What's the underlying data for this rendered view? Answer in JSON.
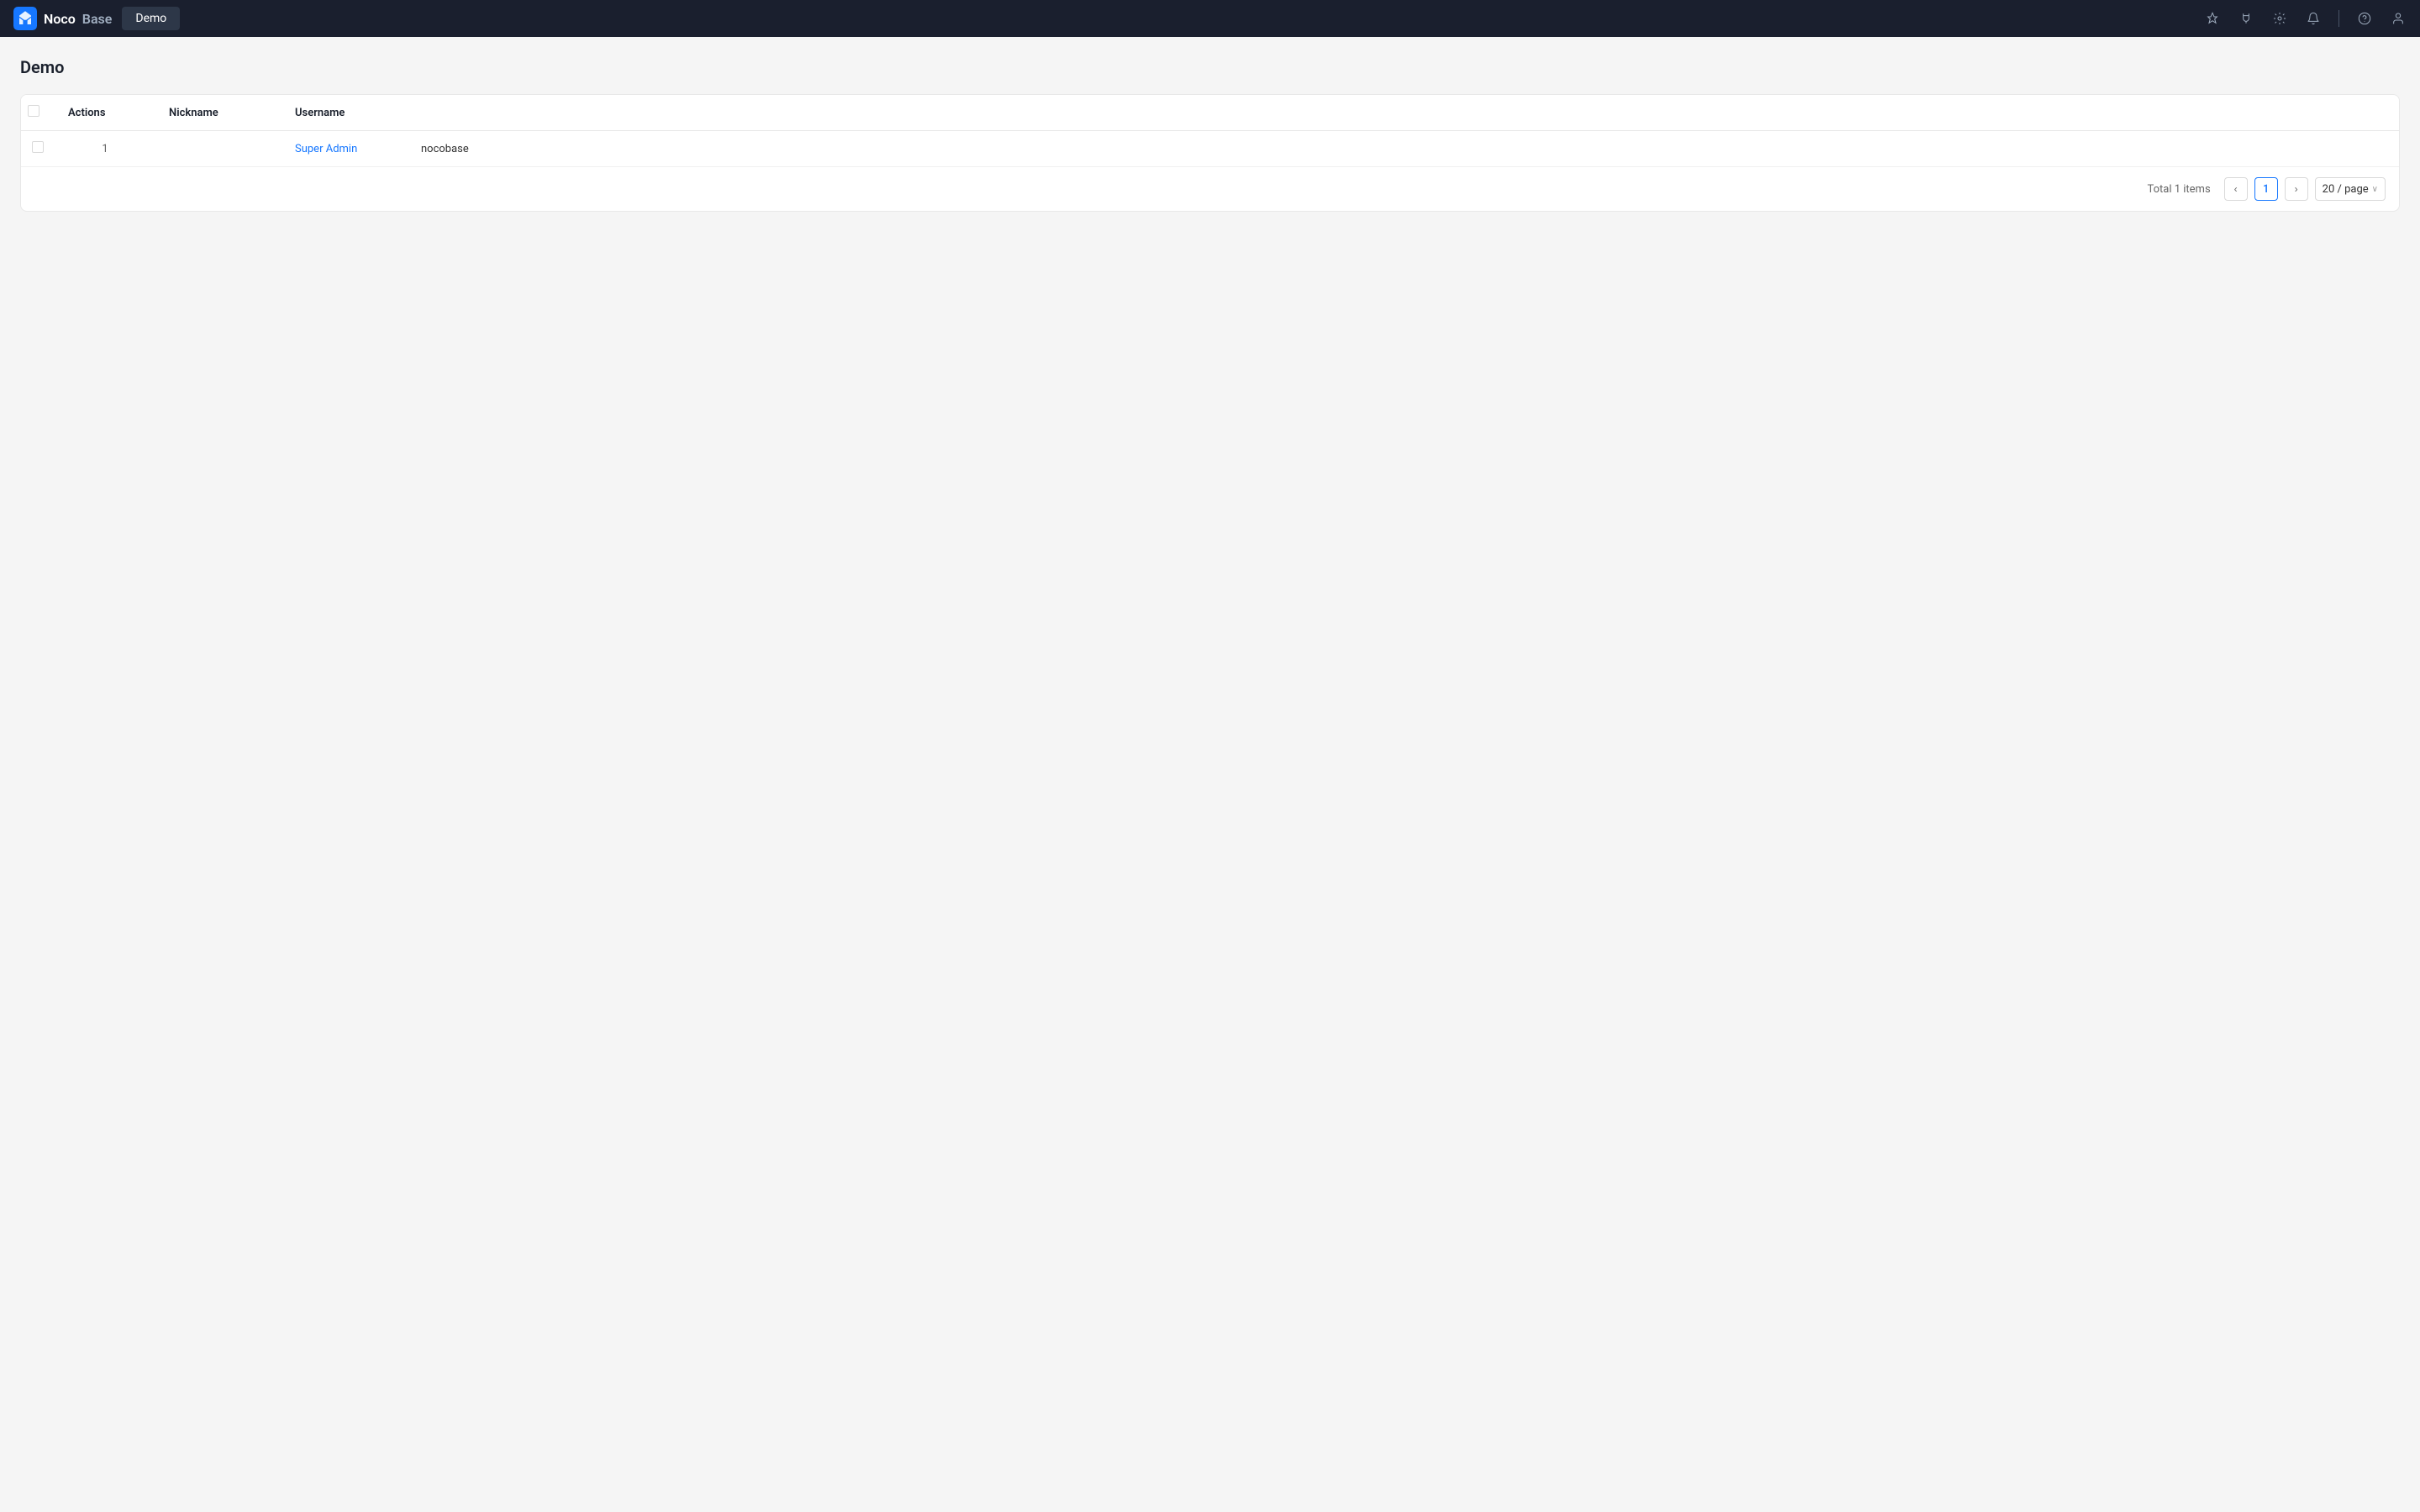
{
  "header": {
    "logo_text_noco": "Noco",
    "logo_text_base": "Base",
    "nav_tab_label": "Demo",
    "icons": {
      "pin": "📌",
      "plug": "🔌",
      "gear": "⚙",
      "bell": "🔔",
      "help": "?",
      "user": "👤"
    }
  },
  "page": {
    "title": "Demo"
  },
  "table": {
    "columns": [
      {
        "key": "actions",
        "label": "Actions"
      },
      {
        "key": "nickname",
        "label": "Nickname"
      },
      {
        "key": "username",
        "label": "Username"
      }
    ],
    "rows": [
      {
        "index": 1,
        "actions": "",
        "nickname": "Super Admin",
        "username": "nocobase"
      }
    ]
  },
  "pagination": {
    "total_label": "Total 1 items",
    "current_page": "1",
    "prev_icon": "‹",
    "next_icon": "›",
    "page_size_label": "20 / page",
    "chevron": "∨"
  }
}
